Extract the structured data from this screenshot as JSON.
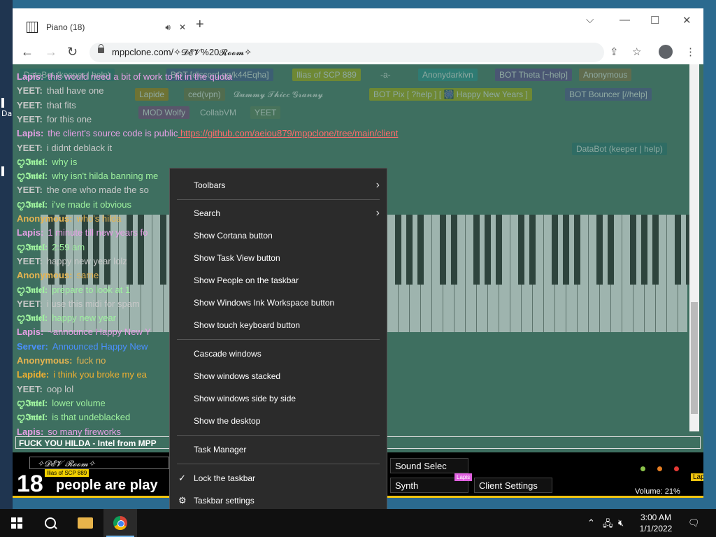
{
  "desktop": {
    "label": "Da"
  },
  "browser": {
    "tab_title": "Piano (18)",
    "audio_icon": "speaker-icon",
    "new_tab": "+",
    "url": "mppclone.com/✧𝓓𝓔𝓥%20𝓡𝓸𝓸𝓶✧"
  },
  "banners": [
    {
      "text": "DataBot (keeper | help)",
      "bg": "#1d6a6a"
    },
    {
      "text": "BOT [discord.gg/k44Eqha]",
      "bg": "#3a4a8a"
    },
    {
      "text": "Ilias of SCP 889",
      "bg": "#a8a800"
    },
    {
      "text": "-a-",
      "bg": "#3e6f60"
    },
    {
      "text": "Anonydarkivn",
      "bg": "#1d8a8a"
    },
    {
      "text": "BOT Theta [~help]",
      "bg": "#5a3a8a"
    },
    {
      "text": "Anonymous",
      "bg": "#8a6a3a"
    },
    {
      "text": "Lapide",
      "bg": "#a87a00"
    },
    {
      "text": "ced(vpn)",
      "bg": "#6a6a3a"
    },
    {
      "text": "𝓓𝓾𝓶𝓶𝔂 𝓣𝓱𝓲𝓬𝓬 𝓖𝓻𝓪𝓷𝓷𝔂",
      "bg": "#3e6f60"
    },
    {
      "text": "BOT Pix [ ?help ] [ 🎆 Happy New Years ]",
      "bg": "#a8a800"
    },
    {
      "text": "BOT Bouncer [//help]",
      "bg": "#4a4a8a"
    },
    {
      "text": "MOD Wolfy",
      "bg": "#7a3a7a"
    },
    {
      "text": "CollabVM",
      "bg": "#3e6f60"
    },
    {
      "text": "YEET",
      "bg": "#557a55"
    },
    {
      "text": "DataBot (keeper | help)",
      "bg": "#1d6a6a"
    }
  ],
  "chat": [
    {
      "name": "Lapis:",
      "text": "this would need a bit of work to fit in the quota",
      "color": "#e6a0e6"
    },
    {
      "name": "YEET:",
      "text": "thatl have one",
      "color": "#c8c8c8"
    },
    {
      "name": "YEET:",
      "text": "that fits",
      "color": "#c8c8c8"
    },
    {
      "name": "YEET:",
      "text": "for this one",
      "color": "#c8c8c8"
    },
    {
      "name": "Lapis:",
      "text": "the client's source code is public",
      "link": "https://github.com/aeiou879/mppclone/tree/main/client",
      "color": "#e6a0e6"
    },
    {
      "name": "YEET:",
      "text": "i didnt deblack it",
      "color": "#c8c8c8"
    },
    {
      "name": "ꨄ𝕴𝖓𝖙𝖊𝖑:",
      "text": "why is",
      "color": "#9ef29e"
    },
    {
      "name": "ꨄ𝕴𝖓𝖙𝖊𝖑:",
      "text": "why isn't hilda banning me",
      "color": "#9ef29e"
    },
    {
      "name": "YEET:",
      "text": "the one who made the so",
      "color": "#c8c8c8"
    },
    {
      "name": "ꨄ𝕴𝖓𝖙𝖊𝖑:",
      "text": "i've made it obvious",
      "color": "#9ef29e"
    },
    {
      "name": "Anonymous:",
      "text": "who's hilda",
      "color": "#e6b450"
    },
    {
      "name": "Lapis:",
      "text": "1 minute till new years fo",
      "color": "#e6a0e6"
    },
    {
      "name": "ꨄ𝕴𝖓𝖙𝖊𝖑:",
      "text": "2:59 am",
      "color": "#9ef29e"
    },
    {
      "name": "YEET:",
      "text": "happy new year lolz",
      "color": "#c8c8c8"
    },
    {
      "name": "Anonymous:",
      "text": "same",
      "color": "#e6b450"
    },
    {
      "name": "ꨄ𝕴𝖓𝖙𝖊𝖑:",
      "text": "prepare to look at 1",
      "color": "#9ef29e"
    },
    {
      "name": "YEET:",
      "text": "i use this midi for spam",
      "color": "#c8c8c8"
    },
    {
      "name": "ꨄ𝕴𝖓𝖙𝖊𝖑:",
      "text": "happy new year",
      "color": "#9ef29e"
    },
    {
      "name": "Lapis:",
      "text": "~announce Happy New Y",
      "color": "#e6a0e6"
    },
    {
      "name": "Server:",
      "text": "Announced Happy New",
      "color": "#4a90ff"
    },
    {
      "name": "Anonymous:",
      "text": "fuck no",
      "color": "#e6b450"
    },
    {
      "name": "Lapide:",
      "text": "i think you broke my ea",
      "color": "#f0b030"
    },
    {
      "name": "YEET:",
      "text": "oop lol",
      "color": "#c8c8c8"
    },
    {
      "name": "ꨄ𝕴𝖓𝖙𝖊𝖑:",
      "text": "lower volume",
      "color": "#9ef29e"
    },
    {
      "name": "ꨄ𝕴𝖓𝖙𝖊𝖑:",
      "text": "is that undeblacked",
      "color": "#9ef29e"
    },
    {
      "name": "Lapis:",
      "text": "so many fireworks",
      "color": "#e6a0e6"
    }
  ],
  "chat_input": "FUCK YOU HILDA - Intel from MPP",
  "bottom": {
    "room": "✧𝓓𝓔𝓥 𝓡𝓸𝓸𝓶✧",
    "count": "18",
    "people_text": "people are play",
    "sound_select": "Sound Selec",
    "synth": "Synth",
    "client_settings": "Client Settings",
    "volume": "Volume: 21%",
    "tag_lapis": "Lapis",
    "tag_ilias": "Ilias of SCP 889",
    "tag_lap": "Lap"
  },
  "context_menu": {
    "items": [
      {
        "label": "Toolbars",
        "submenu": true
      },
      {
        "label": "Search",
        "submenu": true
      },
      {
        "label": "Show Cortana button"
      },
      {
        "label": "Show Task View button"
      },
      {
        "label": "Show People on the taskbar"
      },
      {
        "label": "Show Windows Ink Workspace button"
      },
      {
        "label": "Show touch keyboard button"
      },
      {
        "label": "Cascade windows"
      },
      {
        "label": "Show windows stacked"
      },
      {
        "label": "Show windows side by side"
      },
      {
        "label": "Show the desktop"
      },
      {
        "label": "Task Manager"
      },
      {
        "label": "Lock the taskbar",
        "checked": true
      },
      {
        "label": "Taskbar settings",
        "icon": "gear-icon"
      }
    ]
  },
  "taskbar": {
    "time": "3:00 AM",
    "date": "1/1/2022"
  }
}
